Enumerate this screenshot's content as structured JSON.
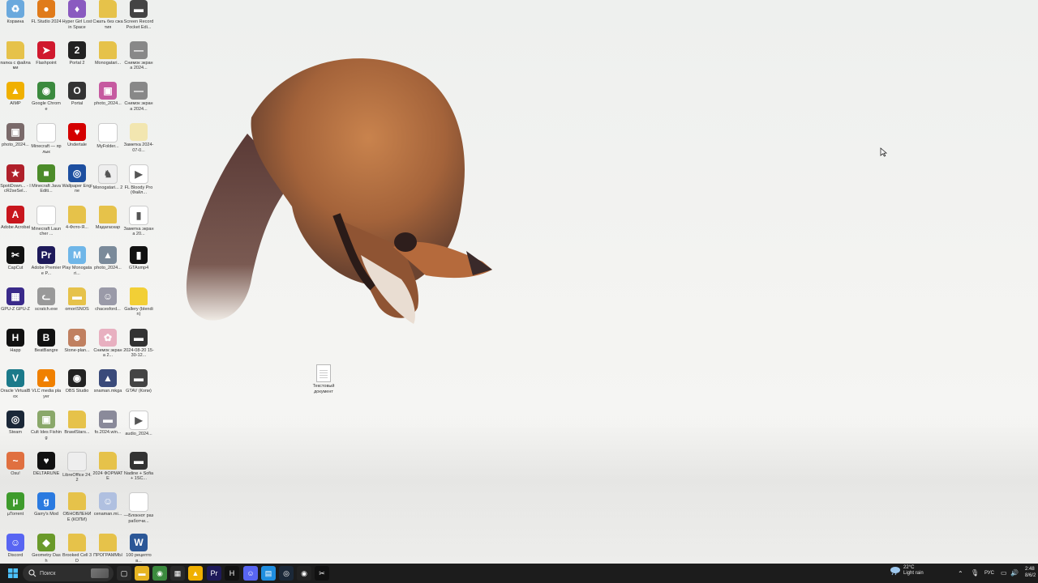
{
  "desktop": {
    "icons": [
      {
        "label": "Корзина",
        "color": "#6aa9dd",
        "glyph": "♻"
      },
      {
        "label": "FL Studio 2024",
        "color": "#e07b1a",
        "glyph": "●"
      },
      {
        "label": "Hyper Girl Lost in Space",
        "color": "#8a5ac0",
        "glyph": "♦"
      },
      {
        "label": "Сжать без сжатия",
        "color": "#e6c24a",
        "glyph": ""
      },
      {
        "label": "Screen Record Pocket Edi...",
        "color": "#444",
        "glyph": "▬"
      },
      {
        "label": "папка с файлами",
        "color": "#e6c24a",
        "glyph": ""
      },
      {
        "label": "Flashpoint",
        "color": "#d0192e",
        "glyph": "➤"
      },
      {
        "label": "Portal 2",
        "color": "#222",
        "glyph": "2"
      },
      {
        "label": "Monogatari...",
        "color": "#e6c24a",
        "glyph": ""
      },
      {
        "label": "Снимок экрана 2024...",
        "color": "#888",
        "glyph": "—"
      },
      {
        "label": "AIMP",
        "color": "#f0b000",
        "glyph": "▲"
      },
      {
        "label": "Google Chrome",
        "color": "#3b8a3e",
        "glyph": "◉"
      },
      {
        "label": "Portal",
        "color": "#333",
        "glyph": "O"
      },
      {
        "label": "photo_2024...",
        "color": "#c65aa0",
        "glyph": "▣"
      },
      {
        "label": "Снимок экрана 2024...",
        "color": "#888",
        "glyph": "—"
      },
      {
        "label": "photo_2024...",
        "color": "#7a6a6a",
        "glyph": "▣"
      },
      {
        "label": "Minecraft — ярлык",
        "color": "#ffffff",
        "glyph": ""
      },
      {
        "label": "Undertale",
        "color": "#d40000",
        "glyph": "♥"
      },
      {
        "label": "MyFolder...",
        "color": "#ffffff",
        "glyph": ""
      },
      {
        "label": "Заметка 2024-07-0...",
        "color": "#f2e6b0",
        "glyph": ""
      },
      {
        "label": "SpotiDown... - IcR2seSel...",
        "color": "#b0202a",
        "glyph": "★"
      },
      {
        "label": "Minecraft Java Editi...",
        "color": "#4c8c2a",
        "glyph": "■"
      },
      {
        "label": "Wallpaper Engine",
        "color": "#1d4fa0",
        "glyph": "◎"
      },
      {
        "label": "Monogatari... 2",
        "color": "#eeeeee",
        "glyph": "♞"
      },
      {
        "label": "FL Bloody Pro (Файл...",
        "color": "#ffffff",
        "glyph": "▶"
      },
      {
        "label": "Adobe Acrobat",
        "color": "#c8161d",
        "glyph": "A"
      },
      {
        "label": "Minecraft Launcher ...",
        "color": "#ffffff",
        "glyph": ""
      },
      {
        "label": "4-Фото-Я...",
        "color": "#e6c24a",
        "glyph": ""
      },
      {
        "label": "Мадагаскар",
        "color": "#e6c24a",
        "glyph": ""
      },
      {
        "label": "Заметка экрана 20...",
        "color": "#ffffff",
        "glyph": "▮"
      },
      {
        "label": "CapCut",
        "color": "#111",
        "glyph": "✂"
      },
      {
        "label": "Adobe Premiere P...",
        "color": "#1e1a5a",
        "glyph": "Pr"
      },
      {
        "label": "Play Monogatari...",
        "color": "#6fb6e8",
        "glyph": "M"
      },
      {
        "label": "photo_2024...",
        "color": "#7a8a9a",
        "glyph": "▲"
      },
      {
        "label": "GTAsmp4",
        "color": "#111",
        "glyph": "▮"
      },
      {
        "label": "GPU-Z GPU-Z",
        "color": "#3a2a8a",
        "glyph": "▦"
      },
      {
        "label": "scratch.exe",
        "color": "#999",
        "glyph": "ᓚ"
      },
      {
        "label": "omoriSNOS",
        "color": "#e6c24a",
        "glyph": "▬"
      },
      {
        "label": "chacesford...",
        "color": "#9a9aa8",
        "glyph": "☺"
      },
      {
        "label": "Gallery (blendin)",
        "color": "#f2cf36",
        "glyph": ""
      },
      {
        "label": "Happ",
        "color": "#111",
        "glyph": "H"
      },
      {
        "label": "BeatBangre",
        "color": "#111",
        "glyph": "B"
      },
      {
        "label": "Stone-plan...",
        "color": "#c08060",
        "glyph": "☻"
      },
      {
        "label": "Снимок экрана 2...",
        "color": "#e8b0c0",
        "glyph": "✿"
      },
      {
        "label": "2024-08-20 15-30-12...",
        "color": "#333",
        "glyph": "▬"
      },
      {
        "label": "Oracle VirtualBox",
        "color": "#1b7a8a",
        "glyph": "V"
      },
      {
        "label": "VLC media player",
        "color": "#f08000",
        "glyph": "▲"
      },
      {
        "label": "OBS Studio",
        "color": "#222",
        "glyph": "◉"
      },
      {
        "label": "snaman.mkga",
        "color": "#3a4a7a",
        "glyph": "▲"
      },
      {
        "label": "GTAV (Копи)",
        "color": "#444",
        "glyph": "▬"
      },
      {
        "label": "Steam",
        "color": "#1b2838",
        "glyph": "◎"
      },
      {
        "label": "Cult Ides Fishing",
        "color": "#8aa86a",
        "glyph": "▣"
      },
      {
        "label": "BrawlStars...",
        "color": "#e6c24a",
        "glyph": ""
      },
      {
        "label": "fo.2024.win...",
        "color": "#8a8a9a",
        "glyph": "▬"
      },
      {
        "label": "audio_2024...",
        "color": "#ffffff",
        "glyph": "▶"
      },
      {
        "label": "Osu!",
        "color": "#e07040",
        "glyph": "~"
      },
      {
        "label": "DELTARUNE",
        "color": "#111",
        "glyph": "♥"
      },
      {
        "label": "LibreOffice 24.2",
        "color": "#eeeeee",
        "glyph": ""
      },
      {
        "label": "2024 ФОРМАТЕ",
        "color": "#e6c24a",
        "glyph": ""
      },
      {
        "label": "Nadine + Sofia + 1SC...",
        "color": "#333",
        "glyph": "▬"
      },
      {
        "label": "µTorrent",
        "color": "#3e9b2c",
        "glyph": "µ"
      },
      {
        "label": "Garry's Mod",
        "color": "#2a7ae0",
        "glyph": "g"
      },
      {
        "label": "ОБНОВЛЕНИЕ (КОПИ)",
        "color": "#e6c24a",
        "glyph": ""
      },
      {
        "label": "cenaman.mi...",
        "color": "#b0c0e0",
        "glyph": "☺"
      },
      {
        "label": "—Блокнот разработчи...",
        "color": "#ffffff",
        "glyph": ""
      },
      {
        "label": "Discord",
        "color": "#5865f2",
        "glyph": "☺"
      },
      {
        "label": "Geometry Dash",
        "color": "#6a9a2a",
        "glyph": "◆"
      },
      {
        "label": "Brooked Cell 3D",
        "color": "#e6c24a",
        "glyph": ""
      },
      {
        "label": "ПРОГРАММЫ",
        "color": "#e6c24a",
        "glyph": ""
      },
      {
        "label": "100 рецептов...",
        "color": "#2b5797",
        "glyph": "W"
      }
    ],
    "free_file": {
      "label": "Текстовый документ"
    }
  },
  "taskbar": {
    "search_placeholder": "Поиск",
    "apps": [
      {
        "name": "task-view",
        "color": "#2a2a2a",
        "glyph": "▢"
      },
      {
        "name": "file-explorer",
        "color": "#e6b422",
        "glyph": "▬"
      },
      {
        "name": "chrome",
        "color": "#3b8a3e",
        "glyph": "◉"
      },
      {
        "name": "store",
        "color": "#2a2a2a",
        "glyph": "▦"
      },
      {
        "name": "aimp",
        "color": "#f0b000",
        "glyph": "▲"
      },
      {
        "name": "premiere",
        "color": "#1e1a5a",
        "glyph": "Pr"
      },
      {
        "name": "happ",
        "color": "#111",
        "glyph": "H"
      },
      {
        "name": "discord",
        "color": "#5865f2",
        "glyph": "☺"
      },
      {
        "name": "vpn",
        "color": "#1f8ee0",
        "glyph": "▤"
      },
      {
        "name": "steam",
        "color": "#1b2838",
        "glyph": "◎"
      },
      {
        "name": "obs",
        "color": "#222",
        "glyph": "◉"
      },
      {
        "name": "capcut",
        "color": "#111",
        "glyph": "✂"
      }
    ],
    "weather": {
      "temp": "22°C",
      "desc": "Light rain"
    },
    "lang": "РУС",
    "time": "2:48",
    "date": "8/6/2"
  }
}
